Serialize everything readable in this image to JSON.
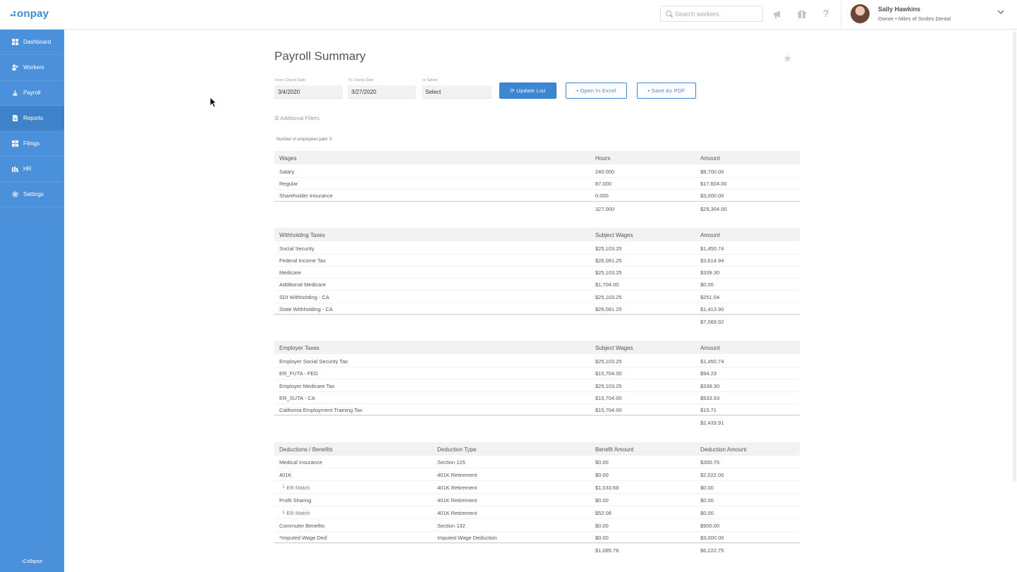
{
  "app": {
    "logo_text": "onpay",
    "brand_color": "#3d8bd6",
    "sidebar_color": "#4a90da"
  },
  "topbar": {
    "search_placeholder": "Search workers",
    "icons": [
      "megaphone-icon",
      "gift-icon",
      "help-icon"
    ],
    "user_name": "Sally Hawkins",
    "user_role": "Owner • Miles of Smiles Dental"
  },
  "sidebar": {
    "items": [
      {
        "label": "Dashboard",
        "icon": "dashboard-icon"
      },
      {
        "label": "Workers",
        "icon": "workers-icon"
      },
      {
        "label": "Payroll",
        "icon": "payroll-icon"
      },
      {
        "label": "Reports",
        "icon": "reports-icon",
        "active": true
      },
      {
        "label": "Filings",
        "icon": "filings-icon"
      },
      {
        "label": "HR",
        "icon": "hr-icon"
      },
      {
        "label": "Settings",
        "icon": "settings-icon"
      }
    ],
    "collapse_label": "Collapse"
  },
  "main": {
    "title": "Payroll Summary",
    "filters": {
      "from_label": "From Check Date",
      "from_value": "3/4/2020",
      "to_label": "To Check Date",
      "to_value": "3/27/2020",
      "select_label": "or Select",
      "select_value": "Select"
    },
    "buttons": {
      "update": "Update List",
      "excel": "Open In Excel",
      "pdf": "Save As PDF"
    },
    "additional_filters": "Additional Filters",
    "employee_count": "Number of employees paid: 3"
  },
  "wages": {
    "headers": [
      "Wages",
      "Hours",
      "Amount"
    ],
    "rows": [
      [
        "Salary",
        "240.000",
        "$8,700.00"
      ],
      [
        "Regular",
        "87.000",
        "$17,604.00"
      ],
      [
        "Shareholder Insurance",
        "0.000",
        "$3,000.00"
      ]
    ],
    "total": [
      "327.000",
      "$29,304.00"
    ]
  },
  "withholding": {
    "headers": [
      "Withholding Taxes",
      "Subject Wages",
      "Amount"
    ],
    "rows": [
      [
        "Social Security",
        "$25,103.25",
        "$1,450.74"
      ],
      [
        "Federal Income Tax",
        "$26,081.25",
        "$3,614.94"
      ],
      [
        "Medicare",
        "$25,103.25",
        "$339.30"
      ],
      [
        "Additional Medicare",
        "$1,704.00",
        "$0.00"
      ],
      [
        "SDI Withholding - CA",
        "$25,103.25",
        "$251.04"
      ],
      [
        "State Withholding - CA",
        "$26,081.25",
        "$1,413.90"
      ]
    ],
    "total": "$7,069.92"
  },
  "employer_taxes": {
    "headers": [
      "Employer Taxes",
      "Subject Wages",
      "Amount"
    ],
    "rows": [
      [
        "Employer Social Security Tax",
        "$25,103.25",
        "$1,450.74"
      ],
      [
        "ER_FUTA - FED",
        "$15,704.00",
        "$94.23"
      ],
      [
        "Employer Medicare Tax",
        "$25,103.25",
        "$339.30"
      ],
      [
        "ER_SUTA - CA",
        "$15,704.00",
        "$533.93"
      ],
      [
        "California Employment Training Tax",
        "$15,704.00",
        "$15.71"
      ]
    ],
    "total": "$2,433.91"
  },
  "deductions": {
    "headers": [
      "Deductions / Benefits",
      "Deduction Type",
      "Benefit Amount",
      "Deduction Amount"
    ],
    "rows": [
      [
        "Medical Insurance",
        "Section 125",
        "$0.00",
        "$300.75"
      ],
      [
        "401K",
        "401K Retirement",
        "$0.00",
        "$2,022.00"
      ],
      [
        "└ ER Match",
        "401K Retirement",
        "$1,033.68",
        "$0.00"
      ],
      [
        "Profit Sharing",
        "401K Retirement",
        "$0.00",
        "$0.00"
      ],
      [
        "└ ER Match",
        "401K Retirement",
        "$52.08",
        "$0.00"
      ],
      [
        "Commuter Benefits",
        "Section 132",
        "$0.00",
        "$900.00"
      ],
      [
        "*Imputed Wage Ded",
        "Imputed Wage Deduction",
        "$0.00",
        "$3,000.00"
      ]
    ],
    "total": [
      "$1,085.76",
      "$6,222.75"
    ]
  }
}
